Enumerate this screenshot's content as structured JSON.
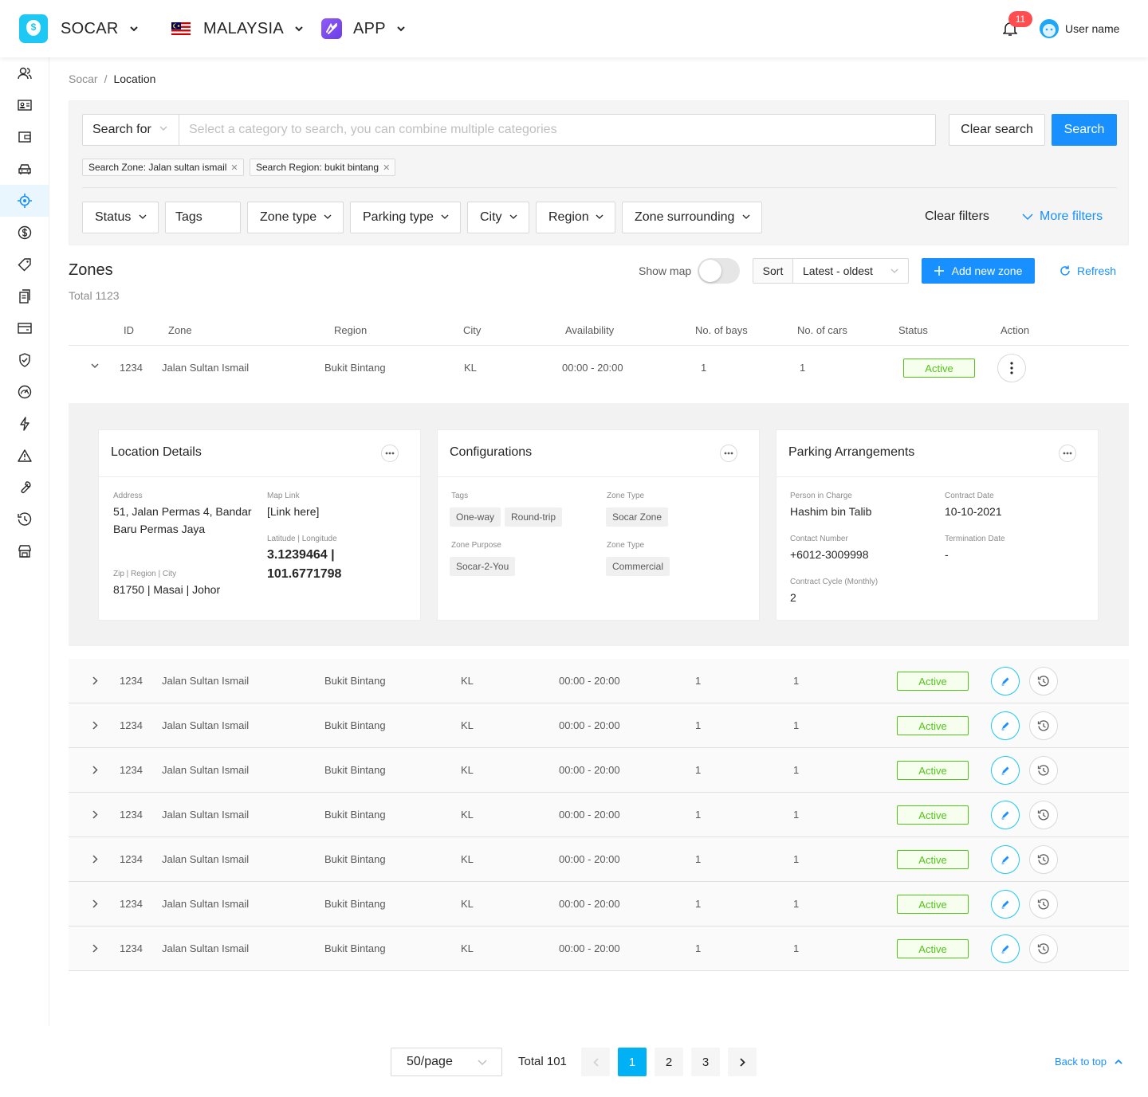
{
  "header": {
    "brand": "SOCAR",
    "logo_letter": "$",
    "country": "MALAYSIA",
    "app": "APP",
    "notification_count": "11",
    "user_name": "User name"
  },
  "sidebar": {
    "icons": [
      "users-icon",
      "id-card-icon",
      "wallet-icon",
      "car-icon",
      "location-target-icon",
      "dollar-icon",
      "tag-icon",
      "documents-icon",
      "card-icon",
      "shield-icon",
      "speedometer-icon",
      "lightning-icon",
      "warning-icon",
      "wrench-icon",
      "clock-icon",
      "store-icon"
    ],
    "active_index": 4
  },
  "breadcrumb": {
    "root": "Socar",
    "sep": "/",
    "current": "Location"
  },
  "search": {
    "search_for": "Search for",
    "placeholder": "Select a category to search, you can combine multiple categories",
    "clear": "Clear search",
    "submit": "Search",
    "chips": [
      "Search Zone: Jalan sultan ismail",
      "Search Region: bukit bintang"
    ]
  },
  "filters": {
    "items": [
      "Status",
      "Tags",
      "Zone type",
      "Parking type",
      "City",
      "Region",
      "Zone surrounding"
    ],
    "clear": "Clear filters",
    "more": "More filters"
  },
  "zones": {
    "title": "Zones",
    "total": "Total 1123",
    "show_map": "Show map",
    "show_map_on": false,
    "sort_label": "Sort",
    "sort_value": "Latest - oldest",
    "add": "Add new zone",
    "refresh": "Refresh"
  },
  "table": {
    "columns": [
      "ID",
      "Zone",
      "Region",
      "City",
      "Availability",
      "No. of bays",
      "No. of cars",
      "Status",
      "Action"
    ],
    "rows": [
      {
        "id": "1234",
        "zone": "Jalan Sultan Ismail",
        "region": "Bukit Bintang",
        "city": "KL",
        "availability": "00:00 - 20:00",
        "bays": "1",
        "cars": "1",
        "status": "Active"
      },
      {
        "id": "1234",
        "zone": "Jalan Sultan Ismail",
        "region": "Bukit Bintang",
        "city": "KL",
        "availability": "00:00 - 20:00",
        "bays": "1",
        "cars": "1",
        "status": "Active"
      },
      {
        "id": "1234",
        "zone": "Jalan Sultan Ismail",
        "region": "Bukit Bintang",
        "city": "KL",
        "availability": "00:00 - 20:00",
        "bays": "1",
        "cars": "1",
        "status": "Active"
      },
      {
        "id": "1234",
        "zone": "Jalan Sultan Ismail",
        "region": "Bukit Bintang",
        "city": "KL",
        "availability": "00:00 - 20:00",
        "bays": "1",
        "cars": "1",
        "status": "Active"
      },
      {
        "id": "1234",
        "zone": "Jalan Sultan Ismail",
        "region": "Bukit Bintang",
        "city": "KL",
        "availability": "00:00 - 20:00",
        "bays": "1",
        "cars": "1",
        "status": "Active"
      },
      {
        "id": "1234",
        "zone": "Jalan Sultan Ismail",
        "region": "Bukit Bintang",
        "city": "KL",
        "availability": "00:00 - 20:00",
        "bays": "1",
        "cars": "1",
        "status": "Active"
      },
      {
        "id": "1234",
        "zone": "Jalan Sultan Ismail",
        "region": "Bukit Bintang",
        "city": "KL",
        "availability": "00:00 - 20:00",
        "bays": "1",
        "cars": "1",
        "status": "Active"
      },
      {
        "id": "1234",
        "zone": "Jalan Sultan Ismail",
        "region": "Bukit Bintang",
        "city": "KL",
        "availability": "00:00 - 20:00",
        "bays": "1",
        "cars": "1",
        "status": "Active"
      }
    ]
  },
  "details": {
    "location": {
      "title": "Location Details",
      "address_label": "Address",
      "address": "51, Jalan Permas 4, Bandar Baru Permas Jaya",
      "map_label": "Map Link",
      "map": "[Link here]",
      "latlng_label": "Latitude | Longitude",
      "lat": "3.1239464 |",
      "lng": "101.6771798",
      "zip_label": "Zip | Region | City",
      "zip": "81750 | Masai | Johor"
    },
    "config": {
      "title": "Configurations",
      "tags_label": "Tags",
      "tags": [
        "One-way",
        "Round-trip"
      ],
      "zone_type_label": "Zone Type",
      "zone_type": "Socar Zone",
      "purpose_label": "Zone Purpose",
      "purpose": "Socar-2-You",
      "zone_type2_label": "Zone Type",
      "zone_type2": "Commercial"
    },
    "parking": {
      "title": "Parking Arrangements",
      "pic_label": "Person in Charge",
      "pic": "Hashim bin Talib",
      "contract_label": "Contract Date",
      "contract": "10-10-2021",
      "contact_label": "Contact Number",
      "contact": "+6012-3009998",
      "term_label": "Termination Date",
      "term": "-",
      "cycle_label": "Contract Cycle (Monthly)",
      "cycle": "2"
    }
  },
  "pagination": {
    "page_size": "50/page",
    "total": "Total 101",
    "pages": [
      "1",
      "2",
      "3"
    ],
    "current": "1",
    "back_to_top": "Back to top"
  },
  "colors": {
    "primary": "#1890ff",
    "brand": "#1ec8f5",
    "success": "#52c41a",
    "danger": "#ff4d4f"
  }
}
